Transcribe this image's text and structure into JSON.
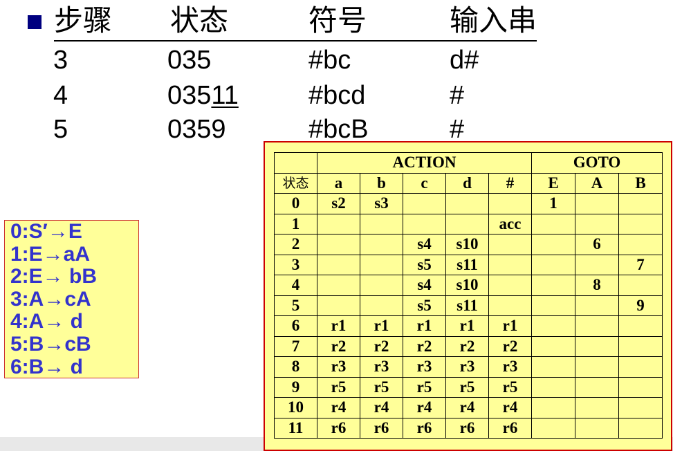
{
  "trace": {
    "headers": [
      "步骤",
      "状态",
      "符号",
      "输入串"
    ],
    "rows": [
      {
        "step": "3",
        "state_plain": "035",
        "state_underlined": "",
        "symbols": "#bc",
        "input": "d#"
      },
      {
        "step": "4",
        "state_plain": "035",
        "state_underlined": "11",
        "symbols": "#bcd",
        "input": "#"
      },
      {
        "step": "5",
        "state_plain": "0359",
        "state_underlined": "",
        "symbols": "#bcB",
        "input": "#"
      }
    ]
  },
  "grammar": {
    "rules": [
      "0:S′→E",
      "1:E→aA",
      "2:E→ bB",
      "3:A→cA",
      "4:A→ d",
      "5:B→cB",
      "6:B→ d"
    ]
  },
  "parse_table": {
    "action_header": "ACTION",
    "goto_header": "GOTO",
    "state_header": "状态",
    "action_symbols": [
      "a",
      "b",
      "c",
      "d",
      "#"
    ],
    "goto_symbols": [
      "E",
      "A",
      "B"
    ],
    "rows": [
      {
        "state": "0",
        "action": [
          "s2",
          "s3",
          "",
          "",
          ""
        ],
        "goto": [
          "1",
          "",
          ""
        ]
      },
      {
        "state": "1",
        "action": [
          "",
          "",
          "",
          "",
          "acc"
        ],
        "goto": [
          "",
          "",
          ""
        ]
      },
      {
        "state": "2",
        "action": [
          "",
          "",
          "s4",
          "s10",
          ""
        ],
        "goto": [
          "",
          "6",
          ""
        ]
      },
      {
        "state": "3",
        "action": [
          "",
          "",
          "s5",
          "s11",
          ""
        ],
        "goto": [
          "",
          "",
          "7"
        ]
      },
      {
        "state": "4",
        "action": [
          "",
          "",
          "s4",
          "s10",
          ""
        ],
        "goto": [
          "",
          "8",
          ""
        ]
      },
      {
        "state": "5",
        "action": [
          "",
          "",
          "s5",
          "s11",
          ""
        ],
        "goto": [
          "",
          "",
          "9"
        ]
      },
      {
        "state": "6",
        "action": [
          "r1",
          "r1",
          "r1",
          "r1",
          "r1"
        ],
        "goto": [
          "",
          "",
          ""
        ]
      },
      {
        "state": "7",
        "action": [
          "r2",
          "r2",
          "r2",
          "r2",
          "r2"
        ],
        "goto": [
          "",
          "",
          ""
        ]
      },
      {
        "state": "8",
        "action": [
          "r3",
          "r3",
          "r3",
          "r3",
          "r3"
        ],
        "goto": [
          "",
          "",
          ""
        ]
      },
      {
        "state": "9",
        "action": [
          "r5",
          "r5",
          "r5",
          "r5",
          "r5"
        ],
        "goto": [
          "",
          "",
          ""
        ]
      },
      {
        "state": "10",
        "action": [
          "r4",
          "r4",
          "r4",
          "r4",
          "r4"
        ],
        "goto": [
          "",
          "",
          ""
        ]
      },
      {
        "state": "11",
        "action": [
          "r6",
          "r6",
          "r6",
          "r6",
          "r6"
        ],
        "goto": [
          "",
          "",
          ""
        ]
      }
    ]
  }
}
